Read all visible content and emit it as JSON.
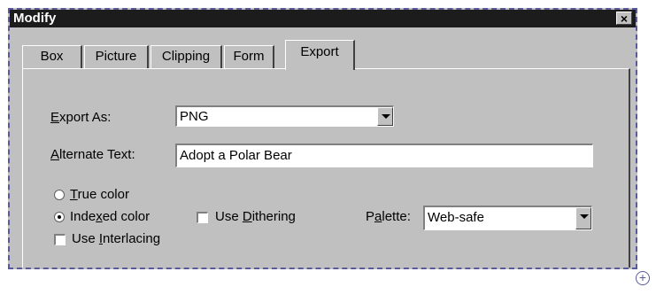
{
  "window": {
    "title": "Modify"
  },
  "tabs": [
    {
      "label": "Box"
    },
    {
      "label": "Picture"
    },
    {
      "label": "Clipping"
    },
    {
      "label": "Form"
    },
    {
      "label": "Export"
    }
  ],
  "export": {
    "export_as": {
      "label_pre": "",
      "label_u": "E",
      "label_post": "xport As:",
      "value": "PNG"
    },
    "alternate_text": {
      "label_pre": "",
      "label_u": "A",
      "label_post": "lternate Text:",
      "value": "Adopt a Polar Bear"
    },
    "true_color": {
      "label_pre": "",
      "label_u": "T",
      "label_post": "rue color",
      "checked": false
    },
    "indexed_color": {
      "label_pre": "Inde",
      "label_u": "x",
      "label_post": "ed color",
      "checked": true
    },
    "use_dithering": {
      "label_pre": "Use ",
      "label_u": "D",
      "label_post": "ithering",
      "checked": false
    },
    "palette": {
      "label_pre": "P",
      "label_u": "a",
      "label_post": "lette:",
      "value": "Web-safe"
    },
    "use_interlacing": {
      "label_pre": "Use ",
      "label_u": "I",
      "label_post": "nterlacing",
      "checked": false
    }
  }
}
